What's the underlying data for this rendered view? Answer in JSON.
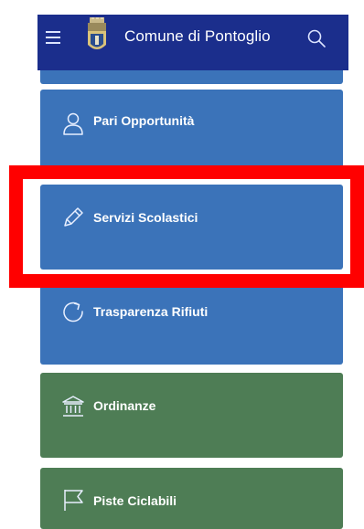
{
  "header": {
    "title": "Comune di Pontoglio",
    "menu_icon": "hamburger-menu-icon",
    "crest_icon": "municipal-crest-icon",
    "search_icon": "search-icon",
    "background_color": "#1b2e8c"
  },
  "cards": [
    {
      "label": "Pari Opportunità",
      "icon": "person-icon",
      "color": "#3b73b9"
    },
    {
      "label": "Servizi Scolastici",
      "icon": "pencil-icon",
      "color": "#3b73b9"
    },
    {
      "label": "Trasparenza Rifiuti",
      "icon": "refresh-icon",
      "color": "#3b73b9"
    },
    {
      "label": "Ordinanze",
      "icon": "institution-icon",
      "color": "#4e7d55"
    },
    {
      "label": "Piste Ciclabili",
      "icon": "flag-icon",
      "color": "#4e7d55"
    }
  ],
  "highlight": {
    "color": "#ff0000",
    "target": "Servizi Scolastici"
  }
}
